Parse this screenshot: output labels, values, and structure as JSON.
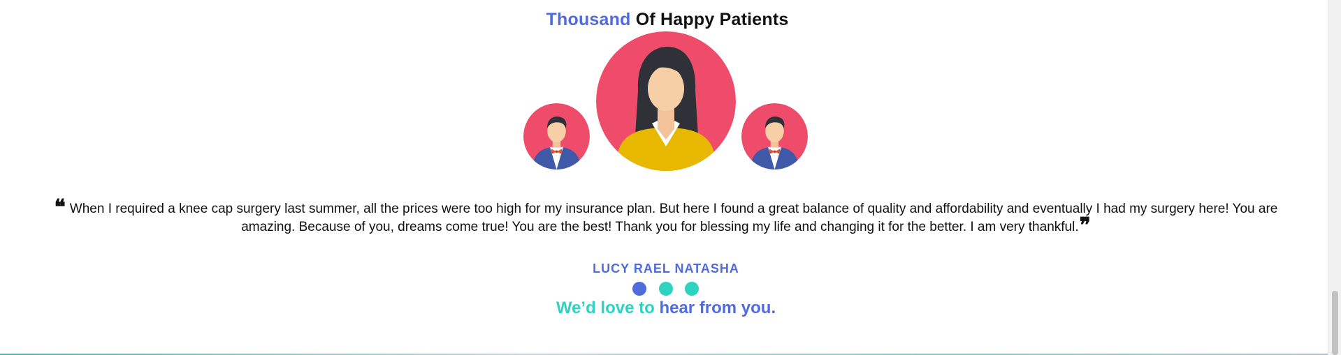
{
  "section": {
    "title_accent": "Thousand",
    "title_rest": "Of Happy Patients"
  },
  "avatars": [
    {
      "name": "male-patient-avatar",
      "bg": "#ef4b6a"
    },
    {
      "name": "female-patient-avatar",
      "bg": "#ef4b6a"
    },
    {
      "name": "male-patient-avatar",
      "bg": "#ef4b6a"
    }
  ],
  "testimonial": {
    "open_quote": "❝",
    "text_line1": "When I required a knee cap surgery last summer, all the prices were too high for my insurance plan. But here I found a great balance of quality and affordability and eventually I had my surgery here! You are",
    "text_line2": "amazing. Because of you, dreams come true! You are the best! Thank you for blessing my life and changing it for the better. I am very thankful.",
    "close_quote": "❞",
    "author": "LUCY RAEL NATASHA"
  },
  "carousel": {
    "dots": [
      {
        "state": "active",
        "color": "#4f6bdc"
      },
      {
        "state": "inactive",
        "color": "#2ed3c0"
      },
      {
        "state": "inactive",
        "color": "#2ed3c0"
      }
    ]
  },
  "contact": {
    "tag_part1": "We’d love to",
    "tag_part2": "hear from you."
  },
  "colors": {
    "accent_blue": "#4f6bdc",
    "accent_teal": "#2ed3c0",
    "text_dark": "#111111"
  }
}
